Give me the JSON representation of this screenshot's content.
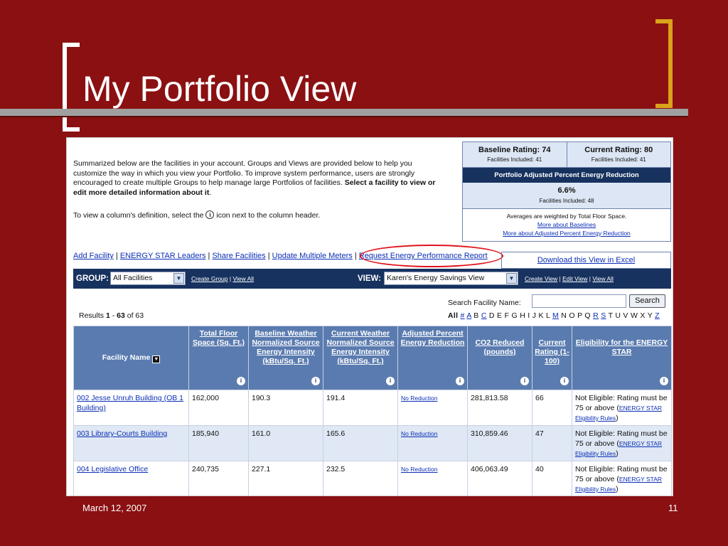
{
  "slide": {
    "title": "My Portfolio View",
    "date": "March 12, 2007",
    "page": "11"
  },
  "intro": {
    "p1": "Summarized below are the facilities in your account. Groups and Views are provided below to help you customize the way in which you view your Portfolio. To improve system performance, users are strongly encouraged to create multiple Groups to help manage large Portfolios of facilities. ",
    "p1_bold": "Select a facility to view or edit more detailed information about it",
    "p1_end": ".",
    "p2_a": "To view a column's definition, select the ",
    "p2_b": " icon next to the column header."
  },
  "rating": {
    "baseline_label": "Baseline Rating: 74",
    "baseline_included": "Facilities Included: 41",
    "current_label": "Current Rating: 80",
    "current_included": "Facilities Included: 41",
    "bar": "Portfolio Adjusted Percent Energy Reduction",
    "percent": "6.6%",
    "percent_included": "Facilities Included: 48",
    "note": "Averages are weighted by Total Floor Space.",
    "link_baselines": "More about Baselines",
    "link_adjusted": "More about Adjusted Percent Energy Reduction"
  },
  "links": {
    "add": "Add Facility",
    "leaders": "ENERGY STAR Leaders",
    "share": "Share Facilities",
    "update": "Update Multiple Meters",
    "request": "Request Energy Performance Report",
    "excel": "Download this View in Excel",
    "sep": " | "
  },
  "group_bar": {
    "group_label": "GROUP:",
    "group_value": "All Facilities",
    "create_group": "Create Group",
    "view_all": "View All",
    "view_label": "VIEW:",
    "view_value": "Karen's Energy Savings View",
    "create_view": "Create View",
    "edit_view": "Edit View",
    "view_all2": "View All"
  },
  "search": {
    "label": "Search Facility Name:",
    "value": "",
    "button": "Search"
  },
  "results": {
    "prefix": "Results ",
    "from": "1",
    "dash": " - ",
    "to": "63",
    "of": " of 63"
  },
  "alpha": {
    "all": "All",
    "hash": "#",
    "A": "A",
    "B": "B",
    "C": "C",
    "D": "D",
    "E": "E",
    "F": "F",
    "G": "G",
    "H": "H",
    "I": "I",
    "J": "J",
    "K": "K",
    "L": "L",
    "M": "M",
    "N": "N",
    "O": "O",
    "P": "P",
    "Q": "Q",
    "R": "R",
    "S": "S",
    "T": "T",
    "U": "U",
    "V": "V",
    "W": "W",
    "X": "X",
    "Y": "Y",
    "Z": "Z"
  },
  "table": {
    "headers": {
      "facility": "Facility Name",
      "floor": "Total Floor Space (Sq. Ft.)",
      "baseline": "Baseline Weather Normalized Source Energy Intensity (kBtu/Sq. Ft.)",
      "current": "Current Weather Normalized Source Energy Intensity (kBtu/Sq. Ft.)",
      "adjusted": "Adjusted Percent Energy Reduction",
      "co2": "CO2 Reduced (pounds)",
      "rating": "Current Rating (1-100)",
      "eligibility": "Eligibility for the ENERGY STAR"
    },
    "rows": [
      {
        "name": "002 Jesse Unruh Building (OB 1 Building)",
        "floor": "162,000",
        "baseline": "190.3",
        "current": "191.4",
        "adjusted": "No Reduction",
        "co2": "281,813.58",
        "rating": "66",
        "elig_a": "Not Eligible: Rating must be 75 or above (",
        "elig_link": "ENERGY STAR Eligibility Rules",
        "elig_b": ")"
      },
      {
        "name": "003 Library-Courts Building",
        "floor": "185,940",
        "baseline": "161.0",
        "current": "165.6",
        "adjusted": "No Reduction",
        "co2": "310,859.46",
        "rating": "47",
        "elig_a": "Not Eligible: Rating must be 75 or above (",
        "elig_link": "ENERGY STAR Eligibility Rules",
        "elig_b": ")"
      },
      {
        "name": "004 Legislative Office",
        "floor": "240,735",
        "baseline": "227.1",
        "current": "232.5",
        "adjusted": "No Reduction",
        "co2": "406,063.49",
        "rating": "40",
        "elig_a": "Not Eligible: Rating must be 75 or above (",
        "elig_link": "ENERGY STAR Eligibility Rules",
        "elig_b": ")"
      }
    ]
  },
  "icons": {
    "info": "i",
    "sort": "▼",
    "dropdown": "▼"
  }
}
